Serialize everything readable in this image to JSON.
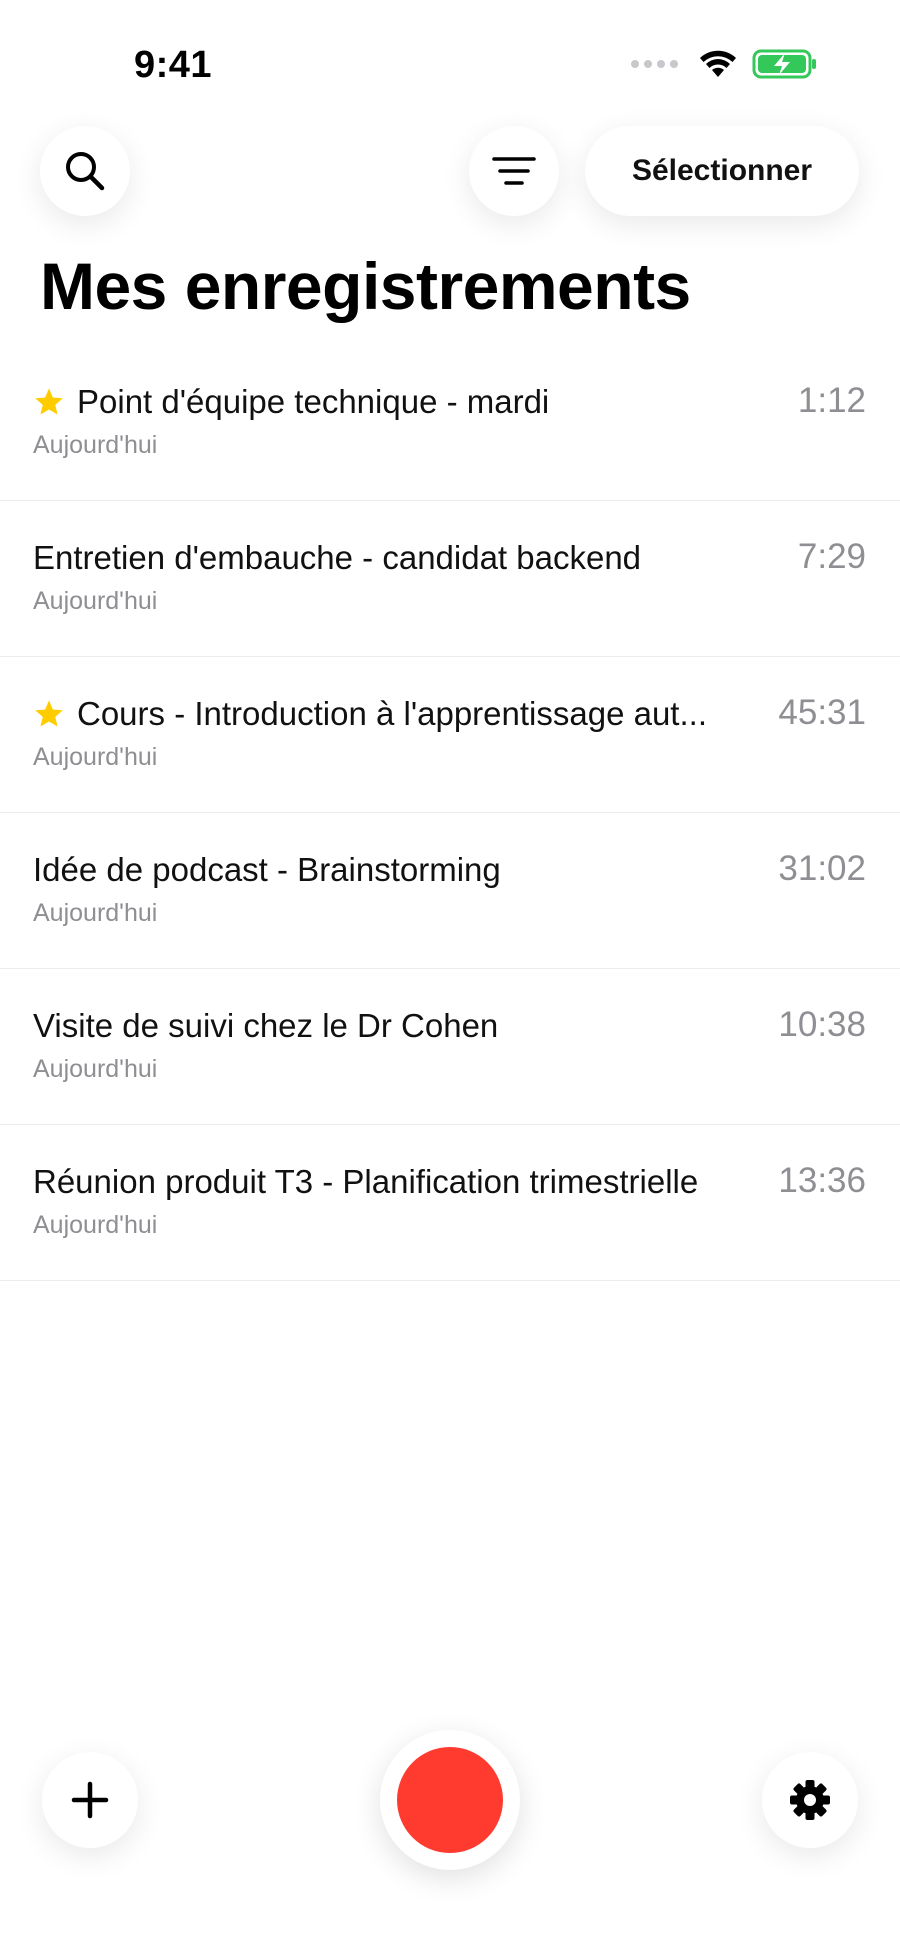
{
  "status_bar": {
    "time": "9:41",
    "icons": [
      "signal-dots-icon",
      "wifi-icon",
      "battery-charging-icon"
    ],
    "battery_color": "#34c759"
  },
  "toolbar": {
    "search_icon": "search-icon",
    "filter_icon": "filter-icon",
    "select_label": "Sélectionner"
  },
  "page": {
    "title": "Mes enregistrements"
  },
  "recordings": [
    {
      "title": "Point d'équipe technique - mardi",
      "date": "Aujourd'hui",
      "duration": "1:12",
      "starred": true
    },
    {
      "title": "Entretien d'embauche - candidat backend",
      "date": "Aujourd'hui",
      "duration": "7:29",
      "starred": false
    },
    {
      "title": "Cours - Introduction à l'apprentissage aut...",
      "date": "Aujourd'hui",
      "duration": "45:31",
      "starred": true
    },
    {
      "title": "Idée de podcast - Brainstorming",
      "date": "Aujourd'hui",
      "duration": "31:02",
      "starred": false
    },
    {
      "title": "Visite de suivi chez le Dr Cohen",
      "date": "Aujourd'hui",
      "duration": "10:38",
      "starred": false
    },
    {
      "title": "Réunion produit T3 - Planification trimestrielle",
      "date": "Aujourd'hui",
      "duration": "13:36",
      "starred": false
    }
  ],
  "bottom_bar": {
    "add_icon": "plus-icon",
    "record_icon": "record-icon",
    "settings_icon": "gear-icon",
    "record_color": "#ff3b30",
    "star_color": "#ffcc00"
  }
}
